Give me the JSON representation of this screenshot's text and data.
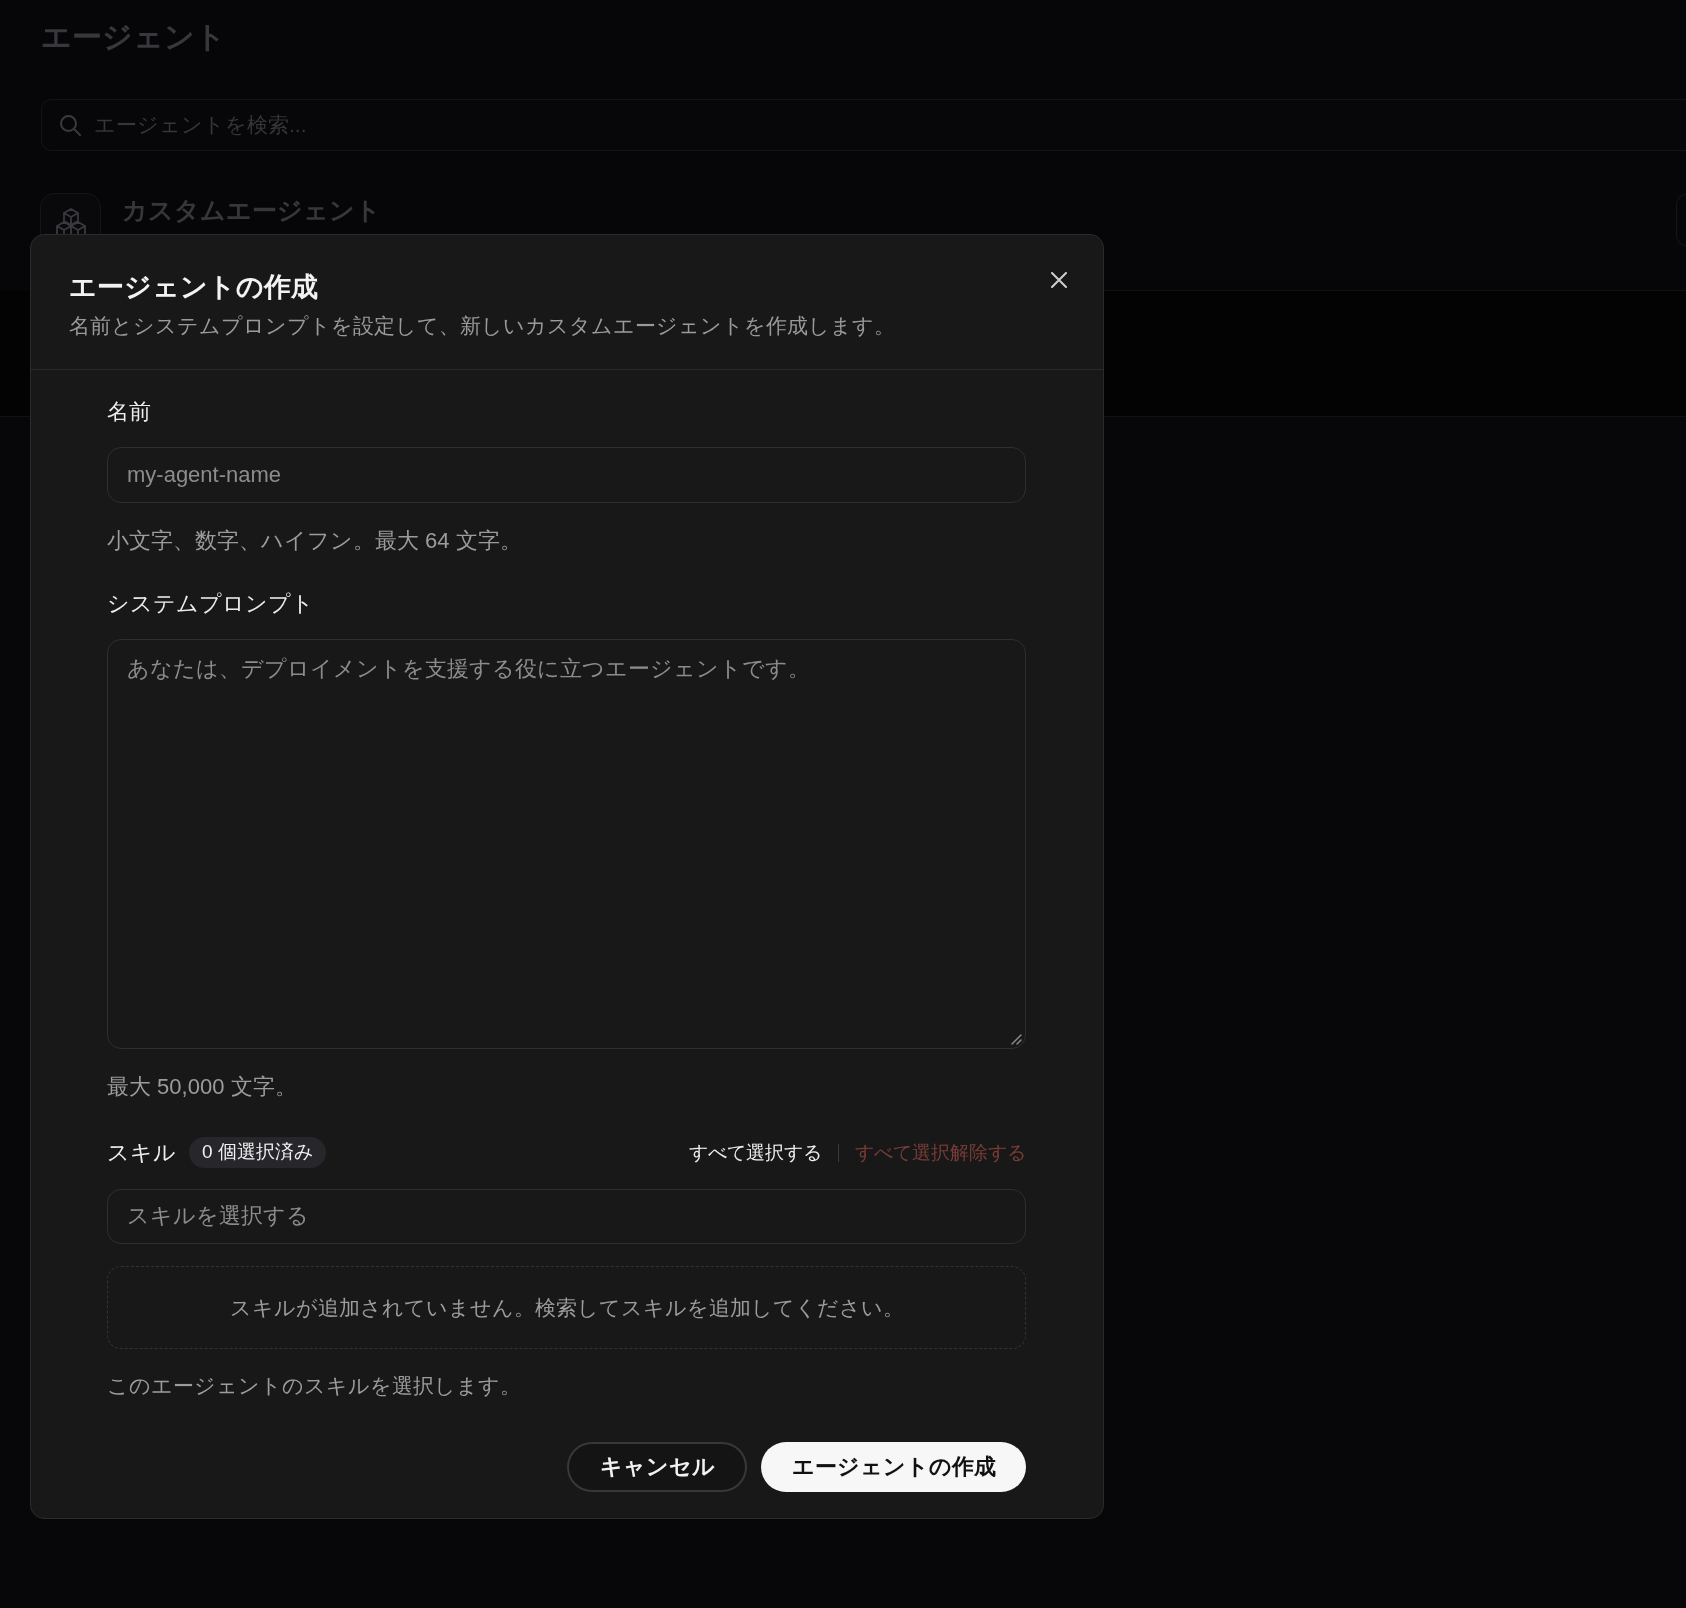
{
  "background_page": {
    "title": "エージェント",
    "search": {
      "placeholder": "エージェントを検索..."
    },
    "agent_card": {
      "title": "カスタムエージェント"
    }
  },
  "dialog": {
    "title": "エージェントの作成",
    "description": "名前とシステムプロンプトを設定して、新しいカスタムエージェントを作成します。",
    "fields": [
      {
        "kind": "input",
        "label": "名前",
        "placeholder": "my-agent-name",
        "help": "小文字、数字、ハイフン。最大 64 文字。"
      },
      {
        "kind": "textarea",
        "label": "システムプロンプト",
        "placeholder": "あなたは、デプロイメントを支援する役に立つエージェントです。",
        "help": "最大 50,000 文字。"
      }
    ],
    "skills": {
      "label": "スキル",
      "count_badge": "0 個選択済み",
      "actions": [
        {
          "label": "すべて選択する",
          "kind": "neutral",
          "disabled": false
        },
        {
          "label": "すべて選択解除する",
          "kind": "destructive",
          "disabled": true
        }
      ],
      "search": {
        "placeholder": "スキルを選択する"
      },
      "empty_message": "スキルが追加されていません。検索してスキルを追加してください。",
      "help": "このエージェントのスキルを選択します。"
    },
    "buttons": [
      {
        "label": "キャンセル",
        "kind": "secondary"
      },
      {
        "label": "エージェントの作成",
        "kind": "primary"
      }
    ]
  }
}
